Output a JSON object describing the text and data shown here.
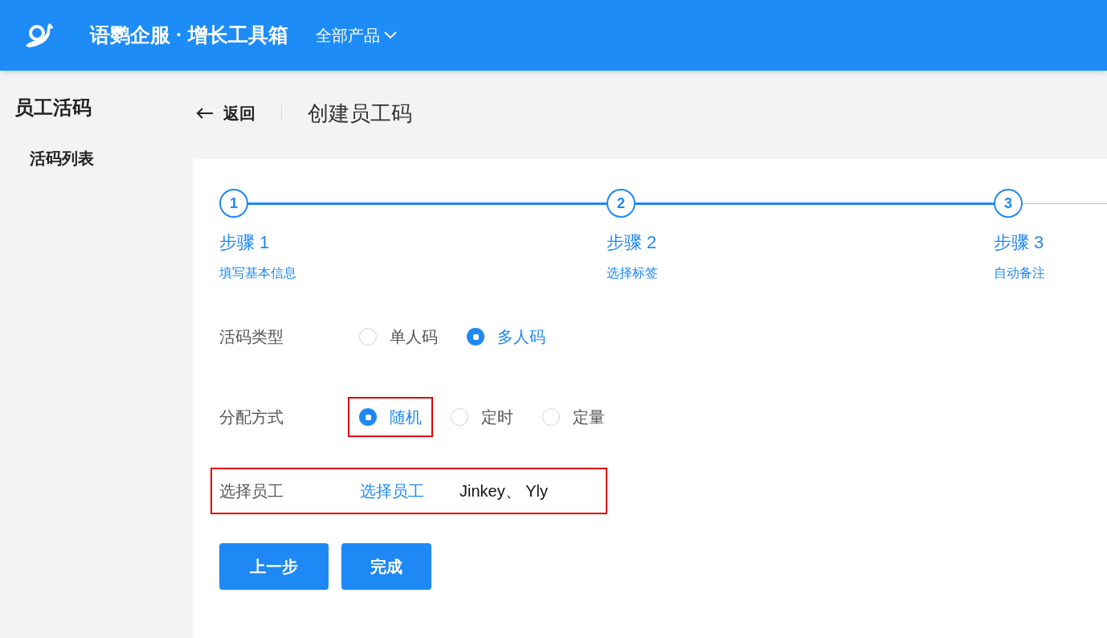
{
  "header": {
    "brand": "语鹦企服 · 增长工具箱",
    "menu": "全部产品"
  },
  "sidebar": {
    "title": "员工活码",
    "items": [
      {
        "label": "活码列表",
        "selected": true
      }
    ]
  },
  "page": {
    "back": "返回",
    "title": "创建员工码"
  },
  "steps": [
    {
      "number": "1",
      "title": "步骤 1",
      "description": "填写基本信息",
      "active": true
    },
    {
      "number": "2",
      "title": "步骤 2",
      "description": "选择标签",
      "active": true
    },
    {
      "number": "3",
      "title": "步骤 3",
      "description": "自动备注",
      "active": true
    }
  ],
  "form": [
    {
      "kind": "radio",
      "label": "活码类型",
      "options": [
        {
          "label": "单人码",
          "selected": false,
          "highlighted": false
        },
        {
          "label": "多人码",
          "selected": true,
          "highlighted": false
        }
      ]
    },
    {
      "kind": "radio",
      "label": "分配方式",
      "options": [
        {
          "label": "随机",
          "selected": true,
          "highlighted": true
        },
        {
          "label": "定时",
          "selected": false,
          "highlighted": false
        },
        {
          "label": "定量",
          "selected": false,
          "highlighted": false
        }
      ]
    },
    {
      "kind": "staff",
      "label": "选择员工",
      "link": "选择员工",
      "value": "Jinkey、 Yly",
      "highlighted": true
    }
  ],
  "buttons": [
    "上一步",
    "完成"
  ]
}
